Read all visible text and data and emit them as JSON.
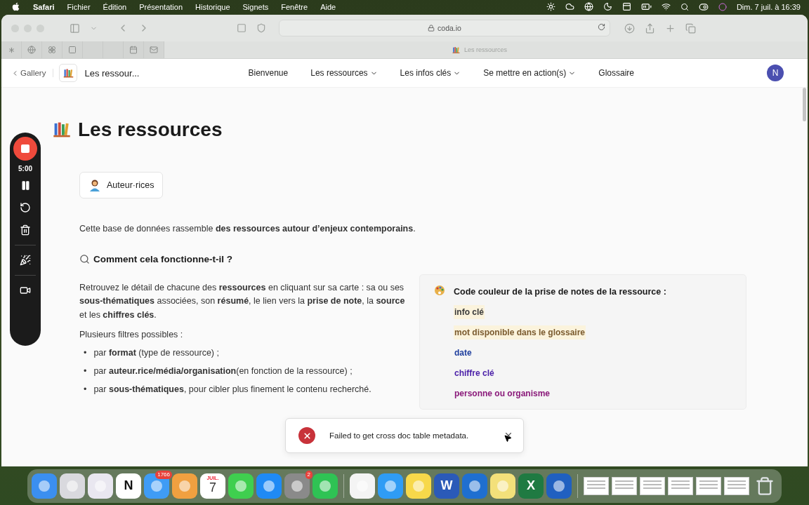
{
  "menu_bar": {
    "app_name": "Safari",
    "menus": [
      "Fichier",
      "Édition",
      "Présentation",
      "Historique",
      "Signets",
      "Fenêtre",
      "Aide"
    ],
    "clock": "Dim. 7 juil. à 16:39"
  },
  "browser": {
    "address": "coda.io",
    "tab_title": "Les ressources"
  },
  "doc_header": {
    "back_link": "Gallery",
    "doc_title": "Les ressour...",
    "avatar": "N",
    "nav": [
      {
        "label": "Bienvenue",
        "has_menu": false
      },
      {
        "label": "Les ressources",
        "has_menu": true
      },
      {
        "label": "Les infos clés",
        "has_menu": true
      },
      {
        "label": "Se mettre en action(s)",
        "has_menu": true
      },
      {
        "label": "Glossaire",
        "has_menu": false
      }
    ]
  },
  "recorder": {
    "timer": "5:00"
  },
  "page": {
    "title": "Les ressources",
    "authors_button": "Auteur·rices",
    "intro": "Cette base de données rassemble **des ressources autour d’enjeux contemporains**.",
    "section_heading": "Comment cela fonctionne-t-il ?",
    "description": "Retrouvez le détail de chacune des **ressources** en cliquant sur sa carte : sa ou ses **sous-thématiques** associées, son **résumé**, le lien vers la **prise de note**, la **source** et les **chiffres clés**.",
    "filters_intro": "Plusieurs filtres possibles :",
    "filters": [
      {
        "bullet": "•",
        "text": "par **format** (type de ressource) ;"
      },
      {
        "bullet": "•",
        "text": "par **auteur.rice/média/organisation**(en fonction de la ressource) ;"
      },
      {
        "bullet": "•",
        "text": "par **sous-thématiques**, pour cibler plus finement le contenu recherché."
      }
    ]
  },
  "callout": {
    "title": "Code couleur de la prise de notes de la ressource :",
    "items": [
      {
        "text": "info clé",
        "color": "#3a3a3a",
        "highlighted": true
      },
      {
        "text": "mot disponible dans le glossaire",
        "color": "#7a5a2e",
        "highlighted": true
      },
      {
        "text": "date",
        "color": "#1f3f9e",
        "highlighted": false
      },
      {
        "text": "chiffre clé",
        "color": "#4a1fa8",
        "highlighted": false
      },
      {
        "text": "personne ou organisme",
        "color": "#8a1a7a",
        "highlighted": false
      }
    ]
  },
  "toast": {
    "message": "Failed to get cross doc table metadata."
  },
  "dock": {
    "items": [
      {
        "kind": "app",
        "color": "#3b8ff0"
      },
      {
        "kind": "app",
        "color": "#d9d9de"
      },
      {
        "kind": "app",
        "color": "#e9e7f0"
      },
      {
        "kind": "app",
        "color": "#ffffff",
        "label": "N"
      },
      {
        "kind": "app",
        "color": "#3f9cf5",
        "badge": "1766"
      },
      {
        "kind": "app",
        "color": "#f0a040"
      },
      {
        "kind": "calendar",
        "month": "JUIL.",
        "day": "7"
      },
      {
        "kind": "app",
        "color": "#3fcf4f"
      },
      {
        "kind": "app",
        "color": "#1f8af5"
      },
      {
        "kind": "app",
        "color": "#8a8a8a",
        "badge": "2"
      },
      {
        "kind": "app",
        "color": "#2fc354"
      },
      {
        "kind": "separator"
      },
      {
        "kind": "app",
        "color": "#f4f4f4"
      },
      {
        "kind": "app",
        "color": "#2f9cf5"
      },
      {
        "kind": "app",
        "color": "#f7d84a"
      },
      {
        "kind": "app",
        "color": "#2b5ab8",
        "label": "W"
      },
      {
        "kind": "app",
        "color": "#1f6fd0"
      },
      {
        "kind": "app",
        "color": "#f3e07a"
      },
      {
        "kind": "app",
        "color": "#1f7a42",
        "label": "X"
      },
      {
        "kind": "app",
        "color": "#2060c0"
      },
      {
        "kind": "separator"
      },
      {
        "kind": "window"
      },
      {
        "kind": "window"
      },
      {
        "kind": "window"
      },
      {
        "kind": "window"
      },
      {
        "kind": "window"
      },
      {
        "kind": "window"
      },
      {
        "kind": "trash"
      }
    ]
  }
}
